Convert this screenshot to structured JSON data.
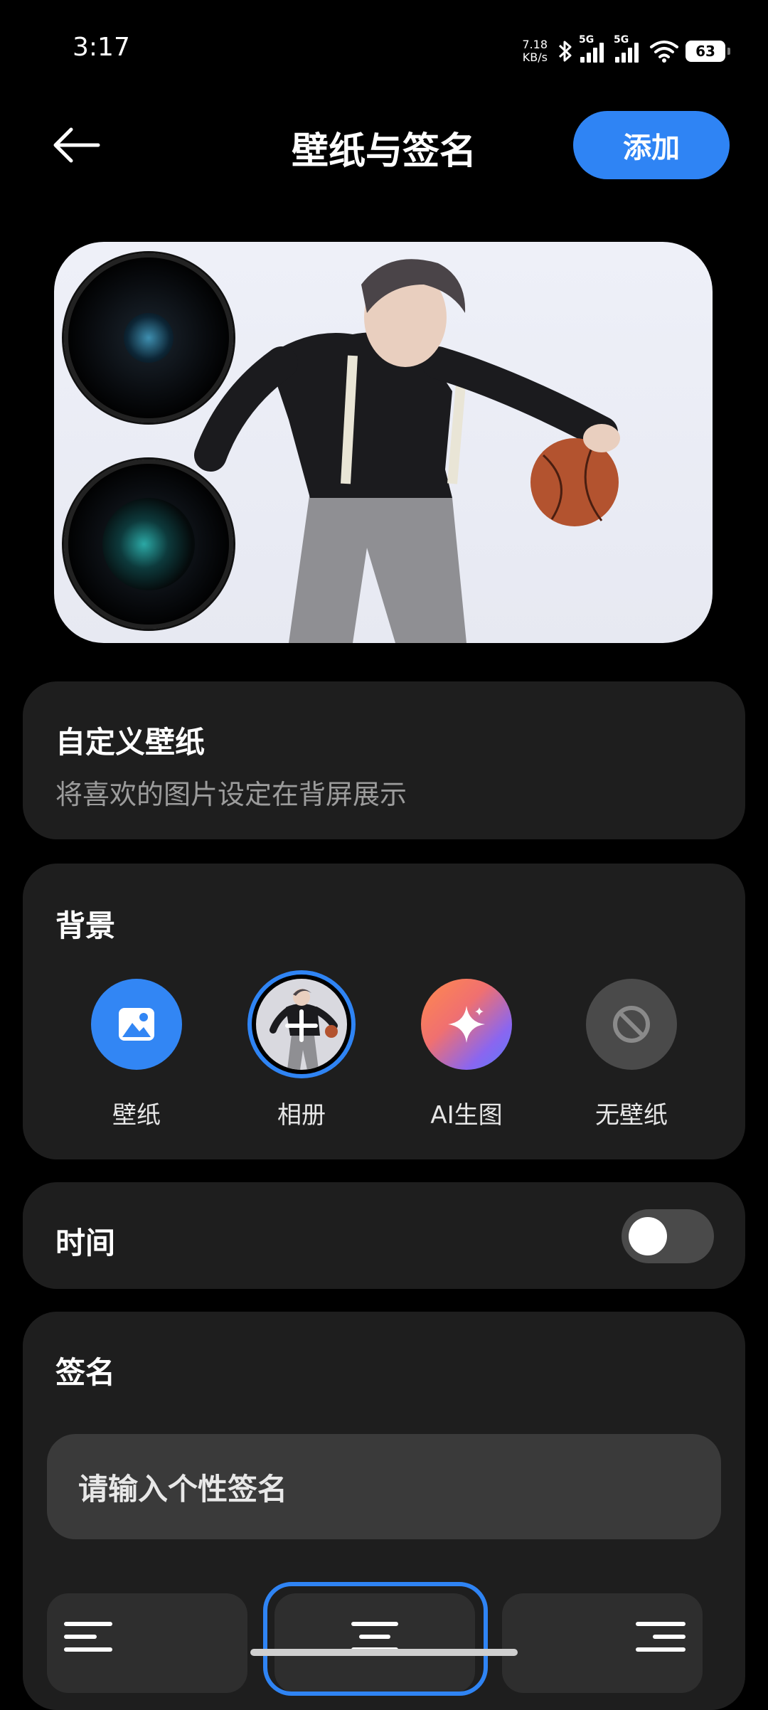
{
  "status_bar": {
    "time": "3:17",
    "net_speed_value": "7.18",
    "net_speed_unit": "KB/s",
    "sim1_type": "5G",
    "sim2_type": "5G",
    "battery": "63"
  },
  "header": {
    "title": "壁纸与签名",
    "add_label": "添加"
  },
  "custom_wallpaper": {
    "title": "自定义壁纸",
    "subtitle": "将喜欢的图片设定在背屏展示"
  },
  "background": {
    "title": "背景",
    "options": [
      {
        "label": "壁纸",
        "icon": "image-icon"
      },
      {
        "label": "相册",
        "icon": "album-thumbnail",
        "selected": true
      },
      {
        "label": "AI生图",
        "icon": "sparkle-icon"
      },
      {
        "label": "无壁纸",
        "icon": "no-entry-icon"
      }
    ]
  },
  "time_setting": {
    "label": "时间",
    "enabled": false
  },
  "signature": {
    "title": "签名",
    "placeholder": "请输入个性签名",
    "alignments": [
      "left",
      "center",
      "right"
    ],
    "selected_alignment": "center"
  },
  "colors": {
    "accent": "#2f84f4",
    "card": "#1e1e1e",
    "background": "#000000"
  }
}
